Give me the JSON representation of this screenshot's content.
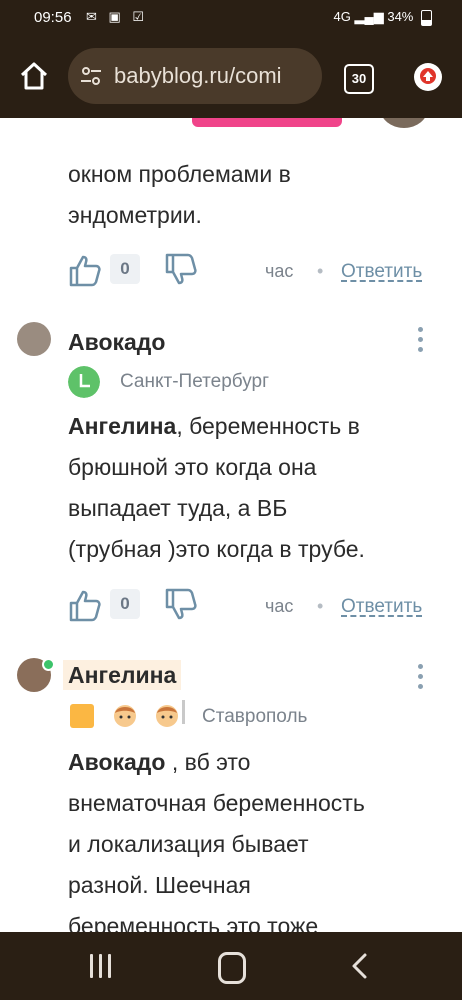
{
  "status_bar": {
    "time": "09:56",
    "battery": "34%",
    "signal_label": "4G"
  },
  "browser": {
    "url": "babyblog.ru/comi",
    "tab_count": "30"
  },
  "comments": [
    {
      "text_line1": "окном проблемами в",
      "text_line2": "эндометрии.",
      "likes": "0",
      "time": "час",
      "reply": "Ответить"
    },
    {
      "author": "Авокадо",
      "city": "Санкт-Петербург",
      "mention": "Ангелина",
      "text_l1_rest": ", беременность в",
      "text_l2": "брюшной это когда она",
      "text_l3": "выпадает туда, а ВБ",
      "text_l4": "(трубная )это когда в трубе.",
      "likes": "0",
      "time": "час",
      "reply": "Ответить"
    },
    {
      "author": "Ангелина",
      "city": "Ставрополь",
      "mention": "Авокадо",
      "text_l1_rest": " , вб это",
      "text_l2": "внематочная беременность",
      "text_l3": "и локализация бывает",
      "text_l4": "разной. Шеечная",
      "text_l5": "беременность это тоже"
    }
  ],
  "colors": {
    "bar_bg": "#2a1f14",
    "accent_pink": "#f0448a",
    "reply_link": "#6e8fa6",
    "city_icon": "#5ec269",
    "badge": "#fbb743"
  }
}
